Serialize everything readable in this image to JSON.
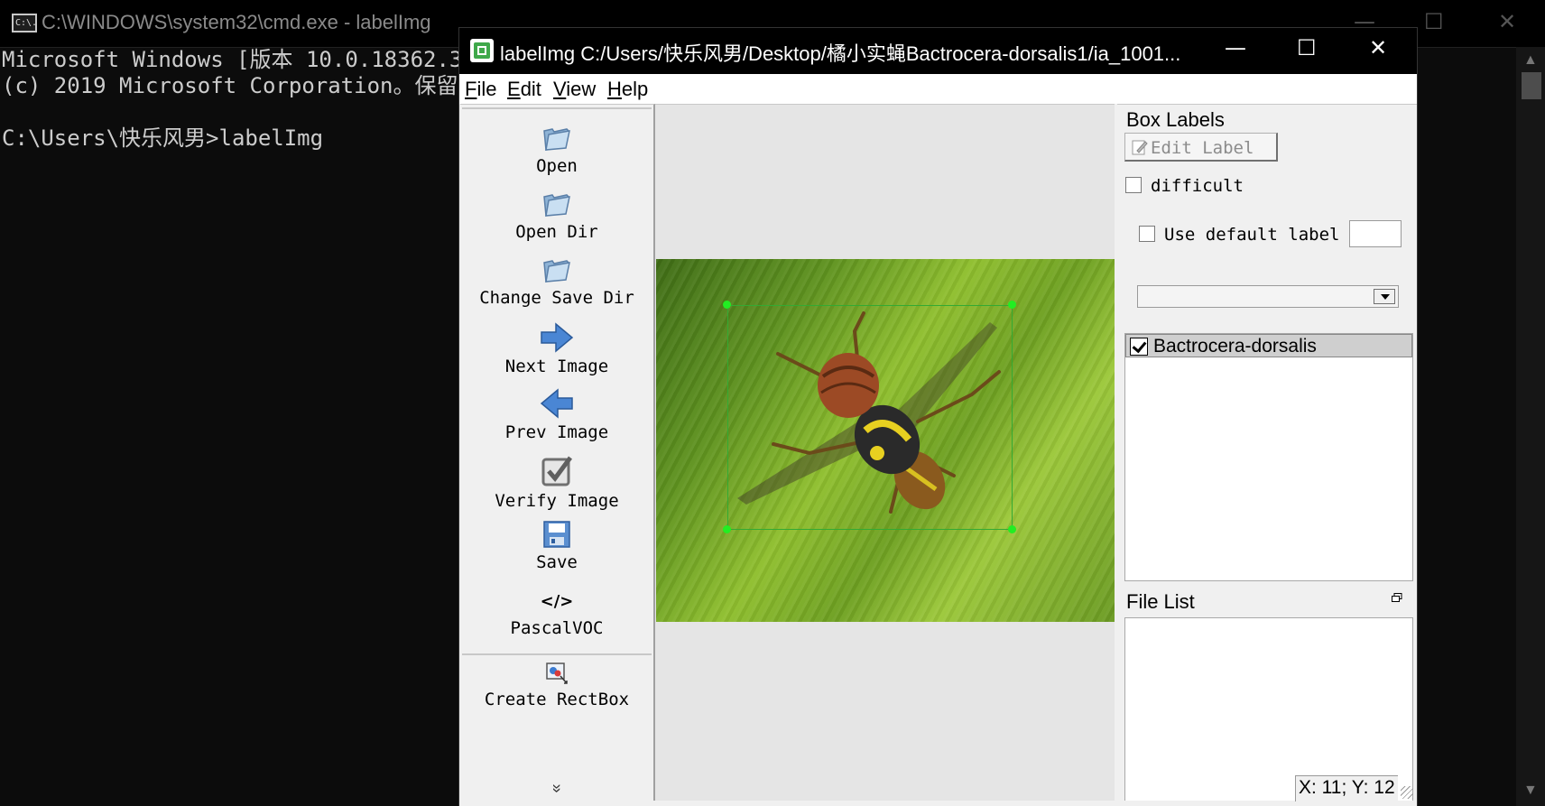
{
  "cmd": {
    "title": "C:\\WINDOWS\\system32\\cmd.exe - labelImg",
    "icon_text": "C:\\.",
    "lines": [
      "Microsoft Windows [版本 10.0.18362.3",
      "(c) 2019 Microsoft Corporation。保留",
      "",
      "C:\\Users\\快乐风男>labelImg"
    ],
    "controls": {
      "minimize": "—",
      "maximize": "☐",
      "close": "✕"
    }
  },
  "labelimg": {
    "title": "labelImg C:/Users/快乐风男/Desktop/橘小实蝇Bactrocera-dorsalis1/ia_1001...",
    "controls": {
      "minimize": "—",
      "maximize": "☐",
      "close": "✕"
    },
    "menu": [
      {
        "key": "F",
        "rest": "ile"
      },
      {
        "key": "E",
        "rest": "dit"
      },
      {
        "key": "V",
        "rest": "iew"
      },
      {
        "key": "H",
        "rest": "elp"
      }
    ],
    "toolbar": {
      "open": "Open",
      "open_dir": "Open Dir",
      "change_save_dir": "Change Save Dir",
      "next_image": "Next Image",
      "prev_image": "Prev Image",
      "verify_image": "Verify Image",
      "save": "Save",
      "format_icon": "</>",
      "format": "PascalVOC",
      "create_rectbox": "Create RectBox",
      "more": "»"
    },
    "dock": {
      "box_labels_title": "Box Labels",
      "edit_label": "Edit Label",
      "difficult": "difficult",
      "use_default_label": "Use default label",
      "default_label_value": "",
      "combo_value": "",
      "labels": [
        {
          "name": "Bactrocera-dorsalis",
          "checked": true
        }
      ],
      "file_list_title": "File List"
    },
    "status": {
      "coords": "X: 11; Y: 12"
    }
  }
}
